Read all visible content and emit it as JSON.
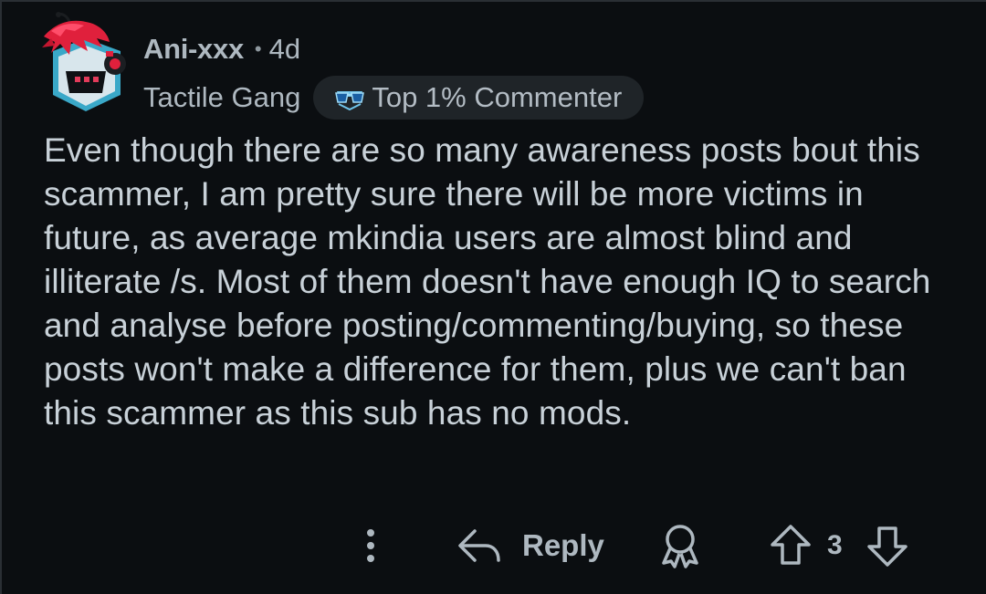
{
  "comment": {
    "author": "Ani-xxx",
    "separator": "•",
    "age": "4d",
    "user_flair": "Tactile Gang",
    "achievement_badge": {
      "label": "Top 1% Commenter",
      "icon": "sunglasses-icon"
    },
    "avatar_icon": "avatar-icon",
    "body": "Even though there are so many awareness posts bout this scammer, I am pretty sure there will be more victims in future, as average mkindia users are almost blind and illiterate /s. Most of them doesn't have enough IQ to search and analyse before posting/commenting/buying, so these posts won't make a difference for them, plus we can't ban this scammer as this sub has no mods."
  },
  "actions": {
    "more_icon": "more-vertical-icon",
    "reply_icon": "reply-arrow-icon",
    "reply_label": "Reply",
    "award_icon": "award-icon",
    "upvote_icon": "upvote-arrow-icon",
    "vote_count": "3",
    "downvote_icon": "downvote-arrow-icon"
  },
  "colors": {
    "background": "#0b0e11",
    "text": "#c8d1d8",
    "muted": "#aeb8c0",
    "badge_bg": "#1f2428",
    "avatar_accent": "#e0203c"
  }
}
